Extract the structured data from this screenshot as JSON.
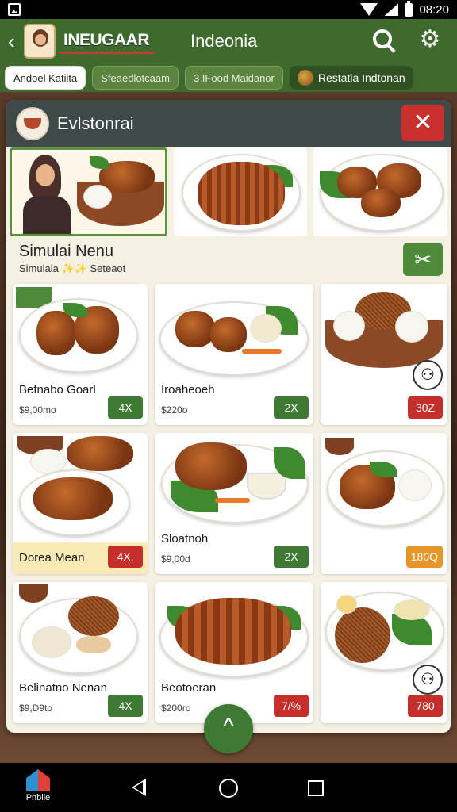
{
  "status_bar": {
    "time": "08:20",
    "icons": [
      "app-notification-icon",
      "wifi-icon",
      "signal-icon",
      "battery-icon"
    ]
  },
  "app_bar": {
    "brand": "INEUGAAR",
    "title": "Indeonia",
    "icons": [
      "back-icon",
      "search-icon",
      "gear-icon"
    ]
  },
  "tabs": [
    {
      "label": "Andoel Katiita",
      "active": true
    },
    {
      "label": "Sfeaedlotcaam",
      "active": false
    },
    {
      "label": "3 IFood Maidanor",
      "active": false
    },
    {
      "label": "Restatia Indtonan",
      "active": false
    }
  ],
  "panel": {
    "title": "Evlstonrai",
    "close_label": "✕",
    "menu_title": "Simulai Nenu",
    "menu_subtitle": "Simulaia ✨✨ Seteaot",
    "tools_label": "✂"
  },
  "menu_items": [
    {
      "name": "Befnabo Goarl",
      "price": "$9,00mo",
      "badge": "4X",
      "badge_color": "#3e7a34"
    },
    {
      "name": "Iroaheoeh",
      "price": "$220o",
      "badge": "2X",
      "badge_color": "#3e7a34"
    },
    {
      "name": "",
      "price": "",
      "badge": "30Z",
      "badge_color": "#c42f2c"
    },
    {
      "name": "Dorea Mean",
      "price": "",
      "badge": "4X.",
      "badge_color": "#c42f2c"
    },
    {
      "name": "Sloatnoh",
      "price": "$9,00d",
      "badge": "2X",
      "badge_color": "#3e7a34"
    },
    {
      "name": "",
      "price": "",
      "badge": "180Q",
      "badge_color": "#e6952b"
    },
    {
      "name": "Belinatno Nenan",
      "price": "$9,D9to",
      "badge": "4X",
      "badge_color": "#3e7a34"
    },
    {
      "name": "Beotoeran",
      "price": "$200ro",
      "badge": "7/%",
      "badge_color": "#c42f2c"
    },
    {
      "name": "",
      "price": "",
      "badge": "780",
      "badge_color": "#c42f2c"
    }
  ],
  "nav_bar": {
    "home_app_label": "Pnbile"
  },
  "scroll_up_label": "^"
}
